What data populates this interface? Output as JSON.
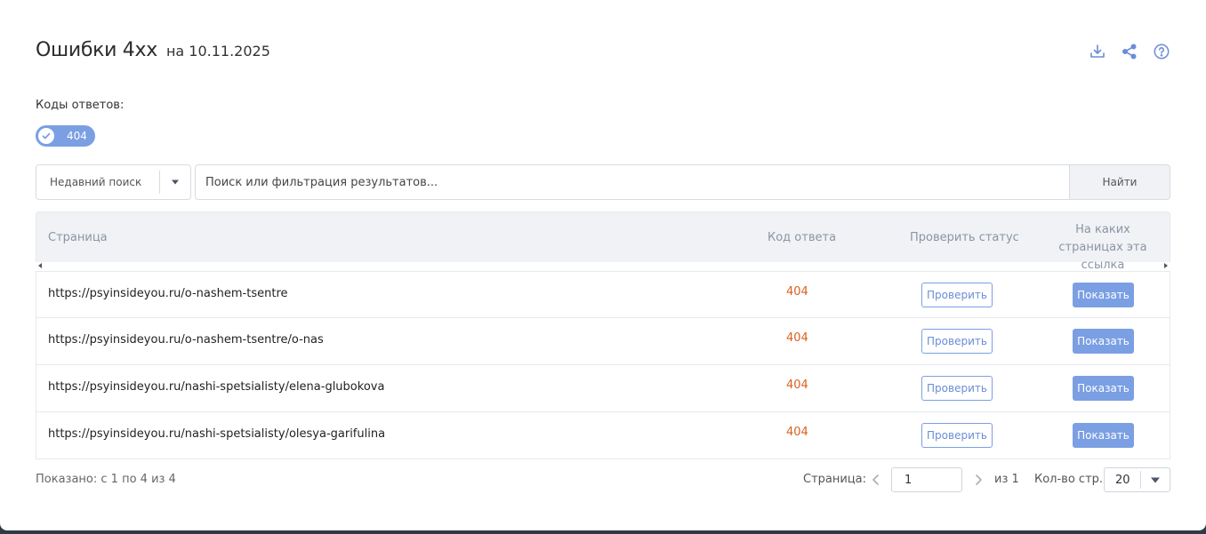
{
  "header": {
    "title": "Ошибки 4хх",
    "subtitle": "на 10.11.2025",
    "icons": [
      "download-icon",
      "share-icon",
      "help-icon"
    ]
  },
  "filters": {
    "codes_label": "Коды ответов:",
    "chips": [
      {
        "label": "404",
        "selected": true
      }
    ]
  },
  "search": {
    "recent_label": "Недавний поиск",
    "placeholder": "Поиск или фильтрация результатов...",
    "value": "",
    "find_label": "Найти"
  },
  "table": {
    "columns": {
      "page": "Страница",
      "code": "Код ответа",
      "check": "Проверить статус",
      "where": "На каких страницах эта ссылка"
    },
    "rows": [
      {
        "url": "https://psyinsideyou.ru/o-nashem-tsentre",
        "code": "404",
        "check_label": "Проверить",
        "show_label": "Показать"
      },
      {
        "url": "https://psyinsideyou.ru/o-nashem-tsentre/o-nas",
        "code": "404",
        "check_label": "Проверить",
        "show_label": "Показать"
      },
      {
        "url": "https://psyinsideyou.ru/nashi-spetsialisty/elena-glubokova",
        "code": "404",
        "check_label": "Проверить",
        "show_label": "Показать"
      },
      {
        "url": "https://psyinsideyou.ru/nashi-spetsialisty/olesya-garifulina",
        "code": "404",
        "check_label": "Проверить",
        "show_label": "Показать"
      }
    ]
  },
  "footer": {
    "shown_text": "Показано: с 1 по 4 из 4",
    "page_label": "Страница:",
    "page_value": "1",
    "of_text": "из 1",
    "per_page_label": "Кол-во стр.:",
    "per_page_value": "20"
  },
  "colors": {
    "accent": "#7b9fe3",
    "error_code": "#d9601e",
    "header_bg": "#f0f2f5"
  }
}
